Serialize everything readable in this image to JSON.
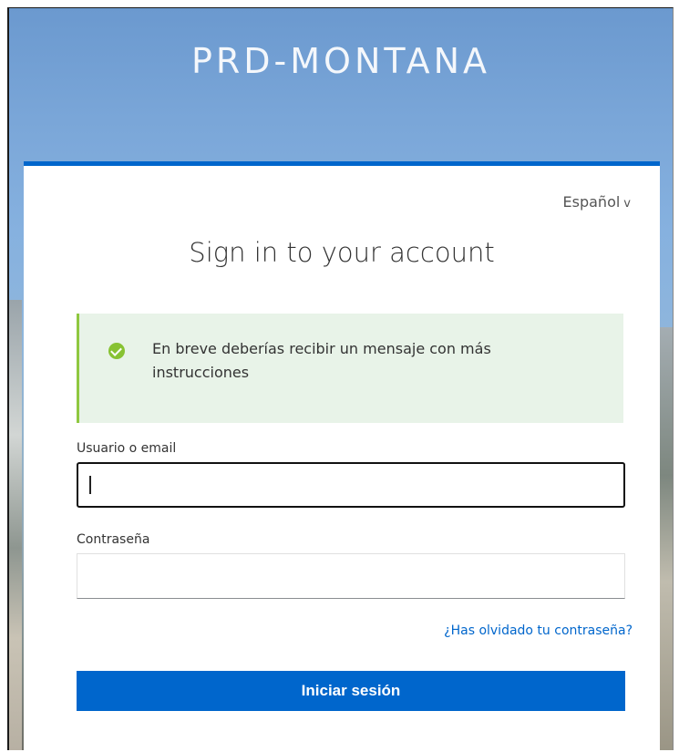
{
  "brand": {
    "title": "PRD-MONTANA"
  },
  "language": {
    "selected": "Español",
    "chevron": "v"
  },
  "login": {
    "heading": "Sign in to your account",
    "alert": {
      "icon": "check-circle-icon",
      "message": "En breve deberías recibir un mensaje con más instrucciones",
      "color": "#8fc840"
    },
    "username": {
      "label": "Usuario o email",
      "value": "",
      "placeholder": ""
    },
    "password": {
      "label": "Contraseña",
      "value": "",
      "placeholder": ""
    },
    "forgot_link": "¿Has olvidado tu contraseña?",
    "submit_label": "Iniciar sesión"
  },
  "colors": {
    "accent": "#0066cc",
    "alert_background": "#e8f3e8",
    "success": "#87c232"
  }
}
